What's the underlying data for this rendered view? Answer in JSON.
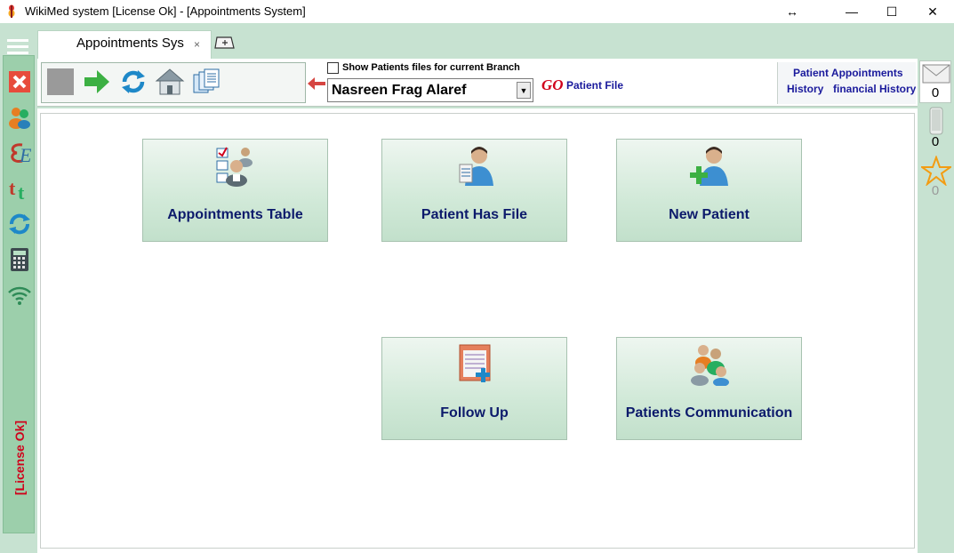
{
  "window": {
    "title": "WikiMed system [License Ok] - [Appointments System]",
    "resize_glyph": "↔",
    "min_glyph": "—",
    "max_glyph": "☐",
    "close_glyph": "✕"
  },
  "sidebar": {
    "icons": [
      "menu-icon",
      "close-x-icon",
      "users-icon",
      "english-e-icon",
      "text-tt-icon",
      "sync-icon",
      "calculator-icon",
      "wifi-icon"
    ],
    "license_text": "[License Ok]"
  },
  "tabs": {
    "active_label": "Appointments Sys",
    "close_glyph": "×"
  },
  "toolbar": {
    "icons": [
      "stop-icon",
      "forward-arrow-icon",
      "refresh-icon",
      "home-icon",
      "documents-icon"
    ],
    "show_branch_label": "Show Patients files for current Branch",
    "patient_name": "Nasreen Frag Alaref",
    "dropdown_glyph": "▼",
    "go_label": "GO",
    "go_patient_file": "Patient File",
    "link_patient_appointments": "Patient Appointments",
    "link_history": "History",
    "link_financial_history": "financial History"
  },
  "right_rail": {
    "mail_count": "0",
    "count2": "0",
    "favorites_count": "0"
  },
  "tiles": {
    "appointments_table": "Appointments Table",
    "patient_has_file": "Patient Has File",
    "new_patient": "New Patient",
    "follow_up": "Follow Up",
    "patients_communication": "Patients Communication"
  },
  "colors": {
    "accent_green": "#9ccfab",
    "link_blue": "#1a1a9c",
    "license_red": "#d0021b",
    "tile_text": "#0c1a6b"
  }
}
